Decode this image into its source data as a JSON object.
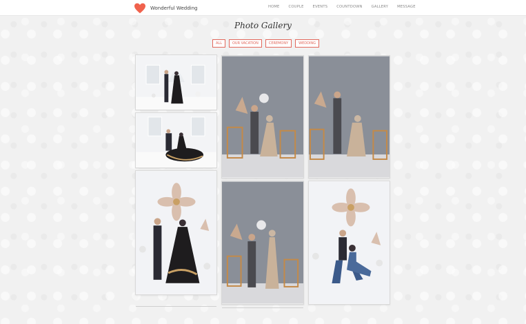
{
  "brand": {
    "name": "Wonderful Wedding",
    "logo_icon": "heart-icon",
    "accent_color": "#f0624d"
  },
  "nav": {
    "items": [
      {
        "label": "HOME"
      },
      {
        "label": "COUPLE"
      },
      {
        "label": "EVENTS"
      },
      {
        "label": "COUNTDOWN"
      },
      {
        "label": "GALLERY"
      },
      {
        "label": "MESSAGE"
      }
    ]
  },
  "gallery": {
    "title": "Photo Gallery",
    "filters": [
      {
        "label": "ALL"
      },
      {
        "label": "OUR VACATION"
      },
      {
        "label": "CEREMONY"
      },
      {
        "label": "WEDDING"
      }
    ],
    "photos": [
      {
        "scene": "white-room-standing",
        "outfit": "black-gold-gown"
      },
      {
        "scene": "white-room-seated",
        "outfit": "black-gold-gown"
      },
      {
        "scene": "flower-studio-standing",
        "outfit": "black-gold-gown"
      },
      {
        "scene": "grey-studio-seated",
        "outfit": "beige-dress"
      },
      {
        "scene": "grey-studio-standing",
        "outfit": "beige-gown"
      },
      {
        "scene": "grey-studio-seated-alt",
        "outfit": "beige-dress"
      },
      {
        "scene": "flower-studio-casual",
        "outfit": "denim"
      }
    ]
  },
  "colors": {
    "filter_accent": "#e2675b",
    "background": "#f1f1f1"
  }
}
